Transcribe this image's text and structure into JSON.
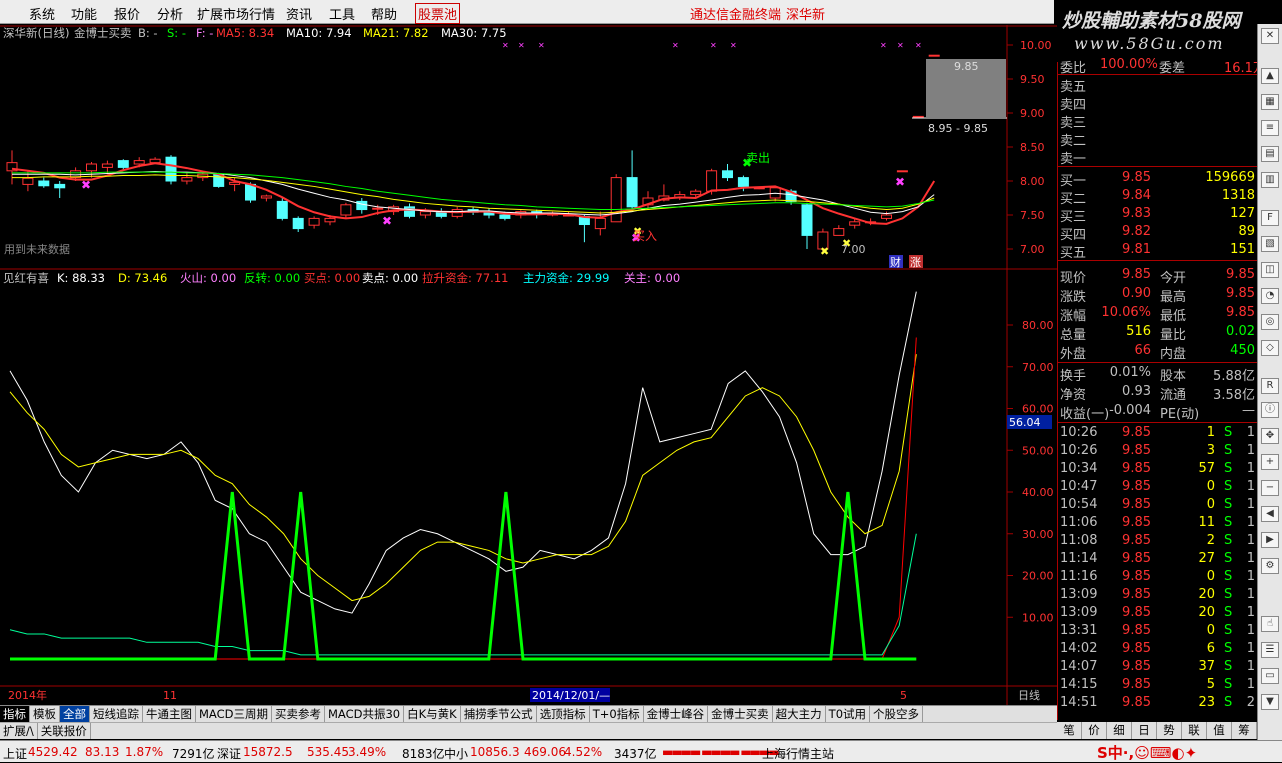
{
  "menu": {
    "items": [
      "系统",
      "功能",
      "报价",
      "分析",
      "扩展市场行情",
      "资讯",
      "工具",
      "帮助"
    ],
    "stock_tab": "股票池",
    "center_title": "通达信金融终端",
    "center_stock": "深华新"
  },
  "brand": {
    "line1": "炒股輔助素材58股网",
    "line2": "www.58Gu.com"
  },
  "main_chart": {
    "stock_label": "深华新(日线)",
    "indicator_name": "金博士买卖",
    "b_label": "B: -",
    "s_label": "S: -",
    "f_label": "F: -",
    "ma5": "MA5: 8.34",
    "ma10": "MA10: 7.94",
    "ma21": "MA21: 7.82",
    "ma30": "MA30: 7.75",
    "future_note": "用到未来数据",
    "sell_label": "卖出",
    "buy_label": "买入",
    "low_price": "7.00",
    "cai_label": "财",
    "zhang_label": "涨",
    "popup_price": "9.85",
    "popup_range": "8.95 - 9.85",
    "y_ticks": [
      "10.00",
      "9.50",
      "9.00",
      "8.50",
      "8.00",
      "7.50",
      "7.00"
    ]
  },
  "sub_chart": {
    "name": "见红有喜",
    "k": "K: 88.33",
    "d": "D: 73.46",
    "huoshan": "火山: 0.00",
    "fanzhuan": "反转: 0.00",
    "maidian": "买点: 0.00",
    "maidian2": "卖点: 0.00",
    "lasheng": "拉升资金: 77.11",
    "zhuli": "主力资金: 29.99",
    "guanzhu": "关主: 0.00",
    "y_ticks": [
      "80.00",
      "70.00",
      "60.00",
      "50.00",
      "40.00",
      "30.00",
      "20.00",
      "10.00"
    ],
    "current_value": "56.04"
  },
  "x_axis": {
    "labels": [
      "2014年",
      "11",
      "2014/12/01/—",
      "5"
    ],
    "period": "日线"
  },
  "colors": {
    "up": "#ff3232",
    "down": "#54ffff",
    "ma5": "#ffffff",
    "ma10": "#ffff00",
    "ma21": "#00ff00",
    "ma30": "#ff80ff",
    "bg": "#000000",
    "price_up": "#ff3232",
    "price_flat": "#ffffff"
  },
  "quote": {
    "weibi_label": "委比",
    "weibi": "100.00%",
    "weicha_label": "委差",
    "weicha": "16.1万",
    "sell": [
      {
        "label": "卖五"
      },
      {
        "label": "卖四"
      },
      {
        "label": "卖三"
      },
      {
        "label": "卖二"
      },
      {
        "label": "卖一"
      }
    ],
    "buy": [
      {
        "label": "买一",
        "price": "9.85",
        "vol": "159669"
      },
      {
        "label": "买二",
        "price": "9.84",
        "vol": "1318"
      },
      {
        "label": "买三",
        "price": "9.83",
        "vol": "127"
      },
      {
        "label": "买四",
        "price": "9.82",
        "vol": "89"
      },
      {
        "label": "买五",
        "price": "9.81",
        "vol": "151"
      }
    ],
    "stats": [
      {
        "l1": "现价",
        "v1": "9.85",
        "l2": "今开",
        "v2": "9.85"
      },
      {
        "l1": "涨跌",
        "v1": "0.90",
        "l2": "最高",
        "v2": "9.85"
      },
      {
        "l1": "涨幅",
        "v1": "10.06%",
        "l2": "最低",
        "v2": "9.85"
      },
      {
        "l1": "总量",
        "v1": "516",
        "l2": "量比",
        "v2": "0.02"
      },
      {
        "l1": "外盘",
        "v1": "66",
        "l2": "内盘",
        "v2": "450"
      }
    ],
    "stats2": [
      {
        "l1": "换手",
        "v1": "0.01%",
        "l2": "股本",
        "v2": "5.88亿"
      },
      {
        "l1": "净资",
        "v1": "0.93",
        "l2": "流通",
        "v2": "3.58亿"
      },
      {
        "l1": "收益(一)",
        "v1": "-0.004",
        "l2": "PE(动)",
        "v2": "—"
      }
    ],
    "ticks": [
      {
        "time": "10:26",
        "price": "9.85",
        "vol": "1",
        "bs": "S",
        "n": "1"
      },
      {
        "time": "10:26",
        "price": "9.85",
        "vol": "3",
        "bs": "S",
        "n": "1"
      },
      {
        "time": "10:34",
        "price": "9.85",
        "vol": "57",
        "bs": "S",
        "n": "1"
      },
      {
        "time": "10:47",
        "price": "9.85",
        "vol": "0",
        "bs": "S",
        "n": "1"
      },
      {
        "time": "10:54",
        "price": "9.85",
        "vol": "0",
        "bs": "S",
        "n": "1"
      },
      {
        "time": "11:06",
        "price": "9.85",
        "vol": "11",
        "bs": "S",
        "n": "1"
      },
      {
        "time": "11:08",
        "price": "9.85",
        "vol": "2",
        "bs": "S",
        "n": "1"
      },
      {
        "time": "11:14",
        "price": "9.85",
        "vol": "27",
        "bs": "S",
        "n": "1"
      },
      {
        "time": "11:16",
        "price": "9.85",
        "vol": "0",
        "bs": "S",
        "n": "1"
      },
      {
        "time": "13:09",
        "price": "9.85",
        "vol": "20",
        "bs": "S",
        "n": "1"
      },
      {
        "time": "13:09",
        "price": "9.85",
        "vol": "20",
        "bs": "S",
        "n": "1"
      },
      {
        "time": "13:31",
        "price": "9.85",
        "vol": "0",
        "bs": "S",
        "n": "1"
      },
      {
        "time": "14:02",
        "price": "9.85",
        "vol": "6",
        "bs": "S",
        "n": "1"
      },
      {
        "time": "14:07",
        "price": "9.85",
        "vol": "37",
        "bs": "S",
        "n": "1"
      },
      {
        "time": "14:15",
        "price": "9.85",
        "vol": "5",
        "bs": "S",
        "n": "1"
      },
      {
        "time": "14:51",
        "price": "9.85",
        "vol": "23",
        "bs": "S",
        "n": "2"
      }
    ]
  },
  "tabs": [
    "指标",
    "模板",
    "全部",
    "短线追踪",
    "牛通主图",
    "MACD三周期",
    "买卖参考",
    "MACD共振30",
    "白K与黄K",
    "捕捞季节公式",
    "选顶指标",
    "T+0指标",
    "金博士峰谷",
    "金博士买卖",
    "超大主力",
    "T0试用",
    "个股空多"
  ],
  "tabs2": [
    "扩展/\\",
    "关联报价"
  ],
  "right_tabs": [
    "笔",
    "价",
    "细",
    "日",
    "势",
    "联",
    "值",
    "筹"
  ],
  "status": {
    "sh_label": "上证",
    "sh_val": "4529.42",
    "sh_chg": "83.13",
    "sh_pct": "1.87%",
    "sh_amt": "7291亿",
    "sz_label": "深证",
    "sz_val": "15872.5",
    "sz_chg": "535.45",
    "sz_pct": "3.49%",
    "sz_amt": "8183亿",
    "zx_label": "中小",
    "zx_val": "10856.3",
    "zx_chg": "469.06",
    "zx_pct": "4.52%",
    "zx_amt": "3437亿",
    "station": "上海行情主站"
  },
  "chart_data": {
    "type": "candlestick",
    "x_labels": [
      "2014年",
      "11",
      "2014/12/01/—",
      "5"
    ],
    "ylim": [
      6.8,
      10.15
    ],
    "candles": [
      [
        8.15,
        8.27,
        7.95,
        8.45
      ],
      [
        7.95,
        8.04,
        7.85,
        8.15
      ],
      [
        8.0,
        7.93,
        7.9,
        8.05
      ],
      [
        7.95,
        7.9,
        7.75,
        8.0
      ],
      [
        8.05,
        8.15,
        8.0,
        8.2
      ],
      [
        8.15,
        8.25,
        8.05,
        8.28
      ],
      [
        8.2,
        8.25,
        8.1,
        8.3
      ],
      [
        8.3,
        8.2,
        8.15,
        8.32
      ],
      [
        8.25,
        8.3,
        8.2,
        8.35
      ],
      [
        8.27,
        8.32,
        8.25,
        8.35
      ],
      [
        8.35,
        8.0,
        7.95,
        8.38
      ],
      [
        8.0,
        8.05,
        7.95,
        8.12
      ],
      [
        8.05,
        8.1,
        8.0,
        8.15
      ],
      [
        8.1,
        7.92,
        7.9,
        8.12
      ],
      [
        7.95,
        7.98,
        7.85,
        8.05
      ],
      [
        7.95,
        7.72,
        7.68,
        7.98
      ],
      [
        7.75,
        7.78,
        7.7,
        7.8
      ],
      [
        7.7,
        7.45,
        7.42,
        7.75
      ],
      [
        7.45,
        7.3,
        7.25,
        7.48
      ],
      [
        7.35,
        7.45,
        7.3,
        7.48
      ],
      [
        7.4,
        7.45,
        7.35,
        7.5
      ],
      [
        7.5,
        7.65,
        7.45,
        7.68
      ],
      [
        7.7,
        7.58,
        7.52,
        7.75
      ],
      [
        7.6,
        7.6,
        7.5,
        7.65
      ],
      [
        7.55,
        7.62,
        7.5,
        7.65
      ],
      [
        7.62,
        7.48,
        7.45,
        7.67
      ],
      [
        7.5,
        7.55,
        7.45,
        7.6
      ],
      [
        7.55,
        7.48,
        7.45,
        7.6
      ],
      [
        7.48,
        7.58,
        7.45,
        7.62
      ],
      [
        7.58,
        7.54,
        7.5,
        7.62
      ],
      [
        7.55,
        7.5,
        7.45,
        7.6
      ],
      [
        7.5,
        7.45,
        7.42,
        7.55
      ],
      [
        7.5,
        7.55,
        7.45,
        7.57
      ],
      [
        7.55,
        7.52,
        7.45,
        7.58
      ],
      [
        7.5,
        7.52,
        7.48,
        7.55
      ],
      [
        7.5,
        7.5,
        7.48,
        7.55
      ],
      [
        7.48,
        7.36,
        7.1,
        7.5
      ],
      [
        7.3,
        7.45,
        7.2,
        7.55
      ],
      [
        7.4,
        8.05,
        7.4,
        8.1
      ],
      [
        8.05,
        7.62,
        7.58,
        8.45
      ],
      [
        7.65,
        7.75,
        7.6,
        7.85
      ],
      [
        7.72,
        7.78,
        7.7,
        7.95
      ],
      [
        7.75,
        7.8,
        7.72,
        7.85
      ],
      [
        7.8,
        7.85,
        7.75,
        7.88
      ],
      [
        7.85,
        8.15,
        7.8,
        8.18
      ],
      [
        8.15,
        8.05,
        8.0,
        8.25
      ],
      [
        8.05,
        7.92,
        7.85,
        8.08
      ],
      [
        7.9,
        7.9,
        7.88,
        7.92
      ],
      [
        7.75,
        7.9,
        7.7,
        7.92
      ],
      [
        7.85,
        7.7,
        7.65,
        7.88
      ],
      [
        7.65,
        7.2,
        7.0,
        7.68
      ],
      [
        7.0,
        7.25,
        6.95,
        7.3
      ],
      [
        7.2,
        7.3,
        7.2,
        7.35
      ],
      [
        7.35,
        7.4,
        7.3,
        7.45
      ],
      [
        7.4,
        7.4,
        7.35,
        7.45
      ],
      [
        7.45,
        7.5,
        7.42,
        7.55
      ],
      [
        8.15,
        8.15,
        8.15,
        8.15
      ],
      [
        8.95,
        8.95,
        8.95,
        8.95
      ],
      [
        9.85,
        9.85,
        9.85,
        9.85
      ]
    ],
    "series": [
      {
        "name": "MA5",
        "color": "#ff3232",
        "values": [
          8.18,
          8.15,
          8.12,
          8.05,
          8.02,
          8.02,
          8.08,
          8.16,
          8.22,
          8.26,
          8.23,
          8.19,
          8.14,
          8.1,
          8.0,
          7.95,
          7.87,
          7.76,
          7.63,
          7.54,
          7.48,
          7.45,
          7.47,
          7.53,
          7.57,
          7.58,
          7.57,
          7.55,
          7.54,
          7.55,
          7.55,
          7.52,
          7.51,
          7.51,
          7.52,
          7.51,
          7.47,
          7.46,
          7.54,
          7.58,
          7.66,
          7.74,
          7.76,
          7.75,
          7.86,
          7.87,
          7.9,
          7.91,
          7.92,
          7.84,
          7.72,
          7.6,
          7.52,
          7.45,
          7.38,
          7.37,
          7.45,
          7.62,
          8.0
        ]
      },
      {
        "name": "MA10",
        "color": "#ffffff",
        "values": [
          8.1,
          8.1,
          8.1,
          8.1,
          8.09,
          8.1,
          8.11,
          8.12,
          8.13,
          8.14,
          8.13,
          8.13,
          8.12,
          8.11,
          8.08,
          8.05,
          8.0,
          7.95,
          7.88,
          7.82,
          7.76,
          7.72,
          7.66,
          7.62,
          7.6,
          7.58,
          7.56,
          7.55,
          7.55,
          7.56,
          7.56,
          7.54,
          7.53,
          7.53,
          7.53,
          7.52,
          7.51,
          7.5,
          7.52,
          7.55,
          7.6,
          7.64,
          7.66,
          7.69,
          7.72,
          7.76,
          7.79,
          7.8,
          7.82,
          7.8,
          7.76,
          7.72,
          7.66,
          7.6,
          7.54,
          7.52,
          7.55,
          7.62,
          7.8
        ]
      },
      {
        "name": "MA21",
        "color": "#ffff00",
        "values": [
          8.05,
          8.05,
          8.06,
          8.06,
          8.06,
          8.07,
          8.07,
          8.08,
          8.08,
          8.09,
          8.08,
          8.08,
          8.07,
          8.06,
          8.05,
          8.03,
          8.01,
          7.98,
          7.95,
          7.92,
          7.88,
          7.84,
          7.8,
          7.77,
          7.73,
          7.7,
          7.67,
          7.65,
          7.63,
          7.62,
          7.6,
          7.59,
          7.58,
          7.57,
          7.56,
          7.55,
          7.54,
          7.53,
          7.54,
          7.56,
          7.58,
          7.6,
          7.62,
          7.64,
          7.66,
          7.68,
          7.7,
          7.71,
          7.72,
          7.71,
          7.7,
          7.68,
          7.66,
          7.63,
          7.6,
          7.58,
          7.6,
          7.66,
          7.75
        ]
      },
      {
        "name": "MA30",
        "color": "#00ff00",
        "values": [
          8.12,
          8.12,
          8.12,
          8.12,
          8.12,
          8.12,
          8.13,
          8.13,
          8.13,
          8.13,
          8.13,
          8.12,
          8.12,
          8.11,
          8.1,
          8.09,
          8.07,
          8.05,
          8.02,
          7.99,
          7.96,
          7.92,
          7.89,
          7.85,
          7.82,
          7.79,
          7.76,
          7.73,
          7.71,
          7.69,
          7.67,
          7.65,
          7.64,
          7.62,
          7.61,
          7.6,
          7.59,
          7.58,
          7.58,
          7.59,
          7.6,
          7.61,
          7.62,
          7.63,
          7.64,
          7.65,
          7.66,
          7.67,
          7.68,
          7.68,
          7.67,
          7.66,
          7.65,
          7.64,
          7.63,
          7.62,
          7.63,
          7.67,
          7.72
        ]
      }
    ],
    "sub_series": [
      {
        "name": "K",
        "color": "#ffffff",
        "values": [
          69,
          62,
          52,
          44,
          40,
          47,
          50,
          49,
          48,
          49,
          52,
          47,
          38,
          36,
          30,
          28,
          22,
          16,
          14,
          12,
          11,
          18,
          26,
          29,
          31,
          30,
          28,
          26,
          24,
          21,
          22,
          26,
          25,
          24,
          26,
          29,
          42,
          65,
          52,
          53,
          54,
          55,
          66,
          69,
          64,
          58,
          47,
          30,
          25,
          25,
          27,
          45,
          68,
          88
        ]
      },
      {
        "name": "D",
        "color": "#ffff00",
        "values": [
          64,
          59,
          55,
          49,
          46,
          47,
          48,
          49,
          49,
          49,
          50,
          48,
          44,
          42,
          37,
          34,
          30,
          24,
          20,
          17,
          14,
          15,
          18,
          22,
          26,
          28,
          28,
          27,
          26,
          24,
          23,
          24,
          25,
          25,
          25,
          27,
          33,
          44,
          47,
          50,
          52,
          53,
          58,
          63,
          65,
          63,
          58,
          50,
          40,
          34,
          30,
          32,
          45,
          73
        ]
      },
      {
        "name": "拉升资金",
        "color": "#ff0000",
        "values": [
          0,
          0,
          0,
          0,
          0,
          0,
          0,
          0,
          0,
          0,
          0,
          0,
          0,
          0,
          0,
          0,
          0,
          0,
          0,
          0,
          0,
          0,
          0,
          0,
          0,
          0,
          0,
          0,
          0,
          0,
          0,
          0,
          0,
          0,
          0,
          0,
          0,
          0,
          0,
          0,
          0,
          0,
          0,
          0,
          0,
          0,
          0,
          0,
          0,
          0,
          0,
          0,
          10,
          77
        ]
      },
      {
        "name": "主力资金",
        "color": "#00ff99",
        "values": [
          7,
          6,
          6,
          5,
          5,
          5,
          5,
          5,
          4,
          4,
          4,
          4,
          3,
          3,
          2,
          2,
          2,
          1,
          1,
          1,
          1,
          1,
          1,
          1,
          1,
          1,
          1,
          1,
          1,
          1,
          1,
          1,
          1,
          1,
          1,
          1,
          1,
          1,
          1,
          1,
          1,
          1,
          1,
          1,
          1,
          1,
          1,
          1,
          1,
          1,
          1,
          1,
          8,
          30
        ]
      },
      {
        "name": "火山",
        "color": "#00ff00",
        "values": [
          0,
          0,
          0,
          0,
          0,
          0,
          0,
          0,
          0,
          0,
          0,
          0,
          0,
          40,
          0,
          0,
          0,
          40,
          0,
          0,
          0,
          0,
          0,
          0,
          0,
          0,
          0,
          0,
          0,
          40,
          0,
          0,
          0,
          0,
          0,
          0,
          0,
          0,
          0,
          0,
          0,
          0,
          0,
          0,
          0,
          0,
          0,
          0,
          0,
          40,
          0,
          0,
          0,
          0
        ]
      }
    ]
  }
}
